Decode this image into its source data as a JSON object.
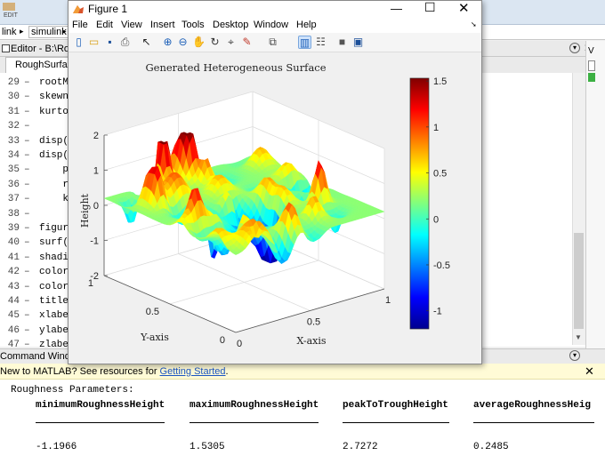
{
  "background": {
    "ribbon_section": "EDIT",
    "path": [
      "link",
      "simulink",
      ""
    ],
    "editor_title": "Editor - B:\\Rou",
    "editor_tab": "RoughSurface",
    "code_lines": [
      {
        "n": "29",
        "t": "rootM"
      },
      {
        "n": "30",
        "t": "skewn"
      },
      {
        "n": "31",
        "t": "kurto"
      },
      {
        "n": "32",
        "t": ""
      },
      {
        "n": "33",
        "t": "disp("
      },
      {
        "n": "34",
        "t": "disp("
      },
      {
        "n": "35",
        "t": "    p"
      },
      {
        "n": "36",
        "t": "    r"
      },
      {
        "n": "37",
        "t": "    k"
      },
      {
        "n": "38",
        "t": ""
      },
      {
        "n": "39",
        "t": "figur"
      },
      {
        "n": "40",
        "t": "surf("
      },
      {
        "n": "41",
        "t": "shadi"
      },
      {
        "n": "42",
        "t": "color"
      },
      {
        "n": "43",
        "t": "color"
      },
      {
        "n": "44",
        "t": "title"
      },
      {
        "n": "45",
        "t": "xlabe"
      },
      {
        "n": "46",
        "t": "ylabe"
      },
      {
        "n": "47",
        "t": "zlabe"
      }
    ],
    "command_window_title": "Command Windo",
    "banner_text": "New to MATLAB? See resources for ",
    "banner_link": "Getting Started",
    "banner_end": ".",
    "output_header": "Roughness Parameters:",
    "columns": [
      "minimumRoughnessHeight",
      "maximumRoughnessHeight",
      "peakToTroughHeight",
      "averageRoughnessHeig"
    ],
    "values": [
      "-1.1966",
      "1.5305",
      "2.7272",
      "0.2485"
    ]
  },
  "figure": {
    "window_title": "Figure 1",
    "menu": [
      "File",
      "Edit",
      "View",
      "Insert",
      "Tools",
      "Desktop",
      "Window",
      "Help"
    ],
    "toolbar_icons": [
      "new-figure-icon",
      "open-file-icon",
      "save-icon",
      "print-icon",
      "select-arrow-icon",
      "zoom-in-icon",
      "zoom-out-icon",
      "pan-hand-icon",
      "rotate-3d-icon",
      "data-cursor-icon",
      "brush-icon",
      "link-plot-icon",
      "colorbar-icon",
      "legend-icon",
      "hide-plot-tools-icon",
      "show-plot-tools-icon"
    ]
  },
  "chart_data": {
    "type": "surface",
    "title": "Generated Heterogeneous Surface",
    "xlabel": "X-axis",
    "ylabel": "Y-axis",
    "zlabel": "Height",
    "xlim": [
      0,
      1
    ],
    "ylim": [
      0,
      1
    ],
    "zlim": [
      -2,
      2
    ],
    "x_ticks": [
      "0",
      "0.5",
      "1"
    ],
    "y_ticks": [
      "0",
      "0.5",
      "1"
    ],
    "z_ticks": [
      "-2",
      "-1",
      "0",
      "1",
      "2"
    ],
    "colorbar": {
      "range": [
        -1.1966,
        1.5305
      ],
      "ticks": [
        "1.5",
        "1",
        "0.5",
        "0",
        "-0.5",
        "-1"
      ],
      "colormap": "jet"
    },
    "grid": true
  }
}
